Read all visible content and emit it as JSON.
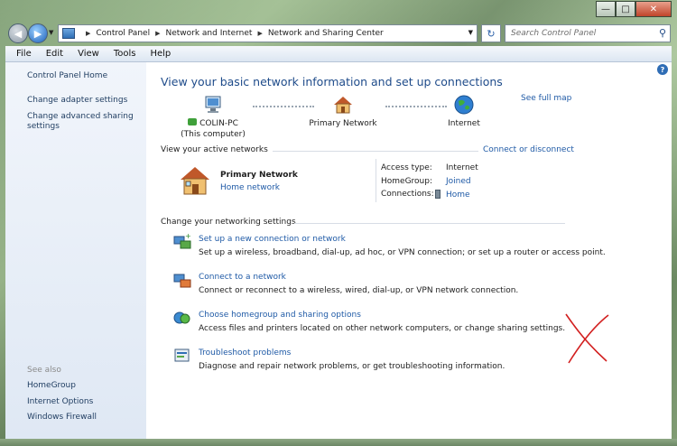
{
  "window": {
    "caption_buttons": [
      "minimize-icon",
      "maximize-icon",
      "close-icon"
    ]
  },
  "navbar": {
    "breadcrumb": [
      "Control Panel",
      "Network and Internet",
      "Network and Sharing Center"
    ],
    "search_placeholder": "Search Control Panel"
  },
  "menu": [
    "File",
    "Edit",
    "View",
    "Tools",
    "Help"
  ],
  "sidebar": {
    "home": "Control Panel Home",
    "links": [
      "Change adapter settings",
      "Change advanced sharing settings"
    ],
    "see_also_label": "See also",
    "see_also": [
      "HomeGroup",
      "Internet Options",
      "Windows Firewall"
    ]
  },
  "main": {
    "title": "View your basic network information and set up connections",
    "see_full_map": "See full map",
    "map": {
      "computer_name": "COLIN-PC",
      "computer_sub": "(This computer)",
      "network": "Primary Network",
      "internet": "Internet"
    },
    "active_label": "View your active networks",
    "connect_disconnect": "Connect or disconnect",
    "active_network": {
      "name": "Primary Network",
      "type_link": "Home network",
      "access_type_label": "Access type:",
      "access_type_value": "Internet",
      "homegroup_label": "HomeGroup:",
      "homegroup_value": "Joined",
      "connections_label": "Connections:",
      "connections_value": "Home"
    },
    "change_label": "Change your networking settings",
    "tasks": [
      {
        "title": "Set up a new connection or network",
        "desc": "Set up a wireless, broadband, dial-up, ad hoc, or VPN connection; or set up a router or access point."
      },
      {
        "title": "Connect to a network",
        "desc": "Connect or reconnect to a wireless, wired, dial-up, or VPN network connection."
      },
      {
        "title": "Choose homegroup and sharing options",
        "desc": "Access files and printers located on other network computers, or change sharing settings."
      },
      {
        "title": "Troubleshoot problems",
        "desc": "Diagnose and repair network problems, or get troubleshooting information."
      }
    ]
  },
  "colors": {
    "link": "#1f5aa6",
    "title": "#1e4b8a",
    "annotation": "#d21f1f"
  }
}
